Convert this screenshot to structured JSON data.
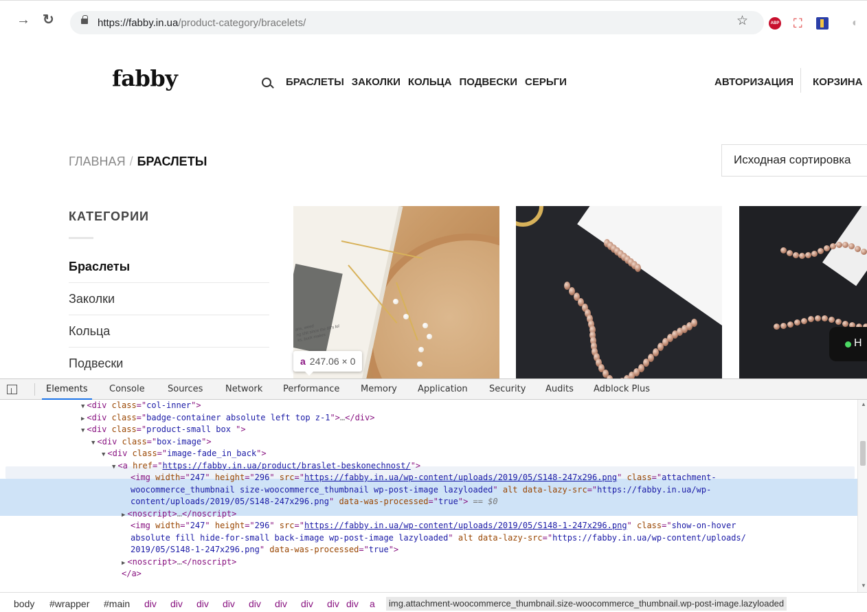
{
  "browser": {
    "url_host": "https://fabby.in.ua",
    "url_path": "/product-category/bracelets/",
    "icons": [
      "back-arrow-icon",
      "reload-icon",
      "lock-icon",
      "star-icon",
      "adblock-icon",
      "extension-cross-icon",
      "extension-blue-icon",
      "extension-gray-icon"
    ],
    "abp_label": "ABP"
  },
  "site": {
    "logo": "fabby",
    "menu": [
      "БРАСЛЕТЫ",
      "ЗАКОЛКИ",
      "КОЛЬЦА",
      "ПОДВЕСКИ",
      "СЕРЬГИ"
    ],
    "auth": "АВТОРИЗАЦИЯ",
    "cart": "КОРЗИНА",
    "breadcrumb": {
      "home": "ГЛАВНАЯ",
      "sep": "/",
      "current": "БРАСЛЕТЫ"
    },
    "sort_label": "Исходная сортировка",
    "categories_title": "КАТЕГОРИИ",
    "categories": [
      "Браслеты",
      "Заколки",
      "Кольца",
      "Подвески"
    ],
    "photo_note": "ans, weed\nng shit since the 80's lol\nks, buck makes",
    "chat_letter": "Н"
  },
  "inspector_tooltip": {
    "tag": "a",
    "size": "247.06 × 0"
  },
  "devtools": {
    "tabs": [
      "Elements",
      "Console",
      "Sources",
      "Network",
      "Performance",
      "Memory",
      "Application",
      "Security",
      "Audits",
      "Adblock Plus"
    ],
    "active_tab": "Elements",
    "breadcrumbs": [
      "body",
      "#wrapper",
      "#main",
      "div",
      "div",
      "div",
      "div",
      "div",
      "div",
      "div",
      "div",
      "div",
      "a",
      "img.attachment-woocommerce_thumbnail.size-woocommerce_thumbnail.wp-post-image.lazyloaded"
    ],
    "code": {
      "col_inner": "col-inner",
      "badge_container": "badge-container absolute left top z-1",
      "product_small": "product-small box ",
      "box_image": "box-image",
      "image_fade": "image-fade_in_back",
      "href": "https://fabby.in.ua/product/braslet-beskonechnost/",
      "img1_width": "247",
      "img1_height": "296",
      "img1_src": "https://fabby.in.ua/wp-content/uploads/2019/05/S148-247x296.png",
      "img1_class_a": "attachment-",
      "img1_class_b": "woocommerce_thumbnail size-woocommerce_thumbnail wp-post-image lazyloaded",
      "img1_lazy_a": "https://fabby.in.ua/wp-",
      "img1_lazy_b": "content/uploads/2019/05/S148-247x296.png",
      "processed": "true",
      "eq": "== $0",
      "img2_src": "https://fabby.in.ua/wp-content/uploads/2019/05/S148-1-247x296.png",
      "img2_class_a": "show-on-hover",
      "img2_class_b": "absolute fill hide-for-small back-image wp-post-image lazyloaded",
      "img2_lazy_a": "https://fabby.in.ua/wp-content/uploads/",
      "img2_lazy_b": "2019/05/S148-1-247x296.png"
    }
  }
}
